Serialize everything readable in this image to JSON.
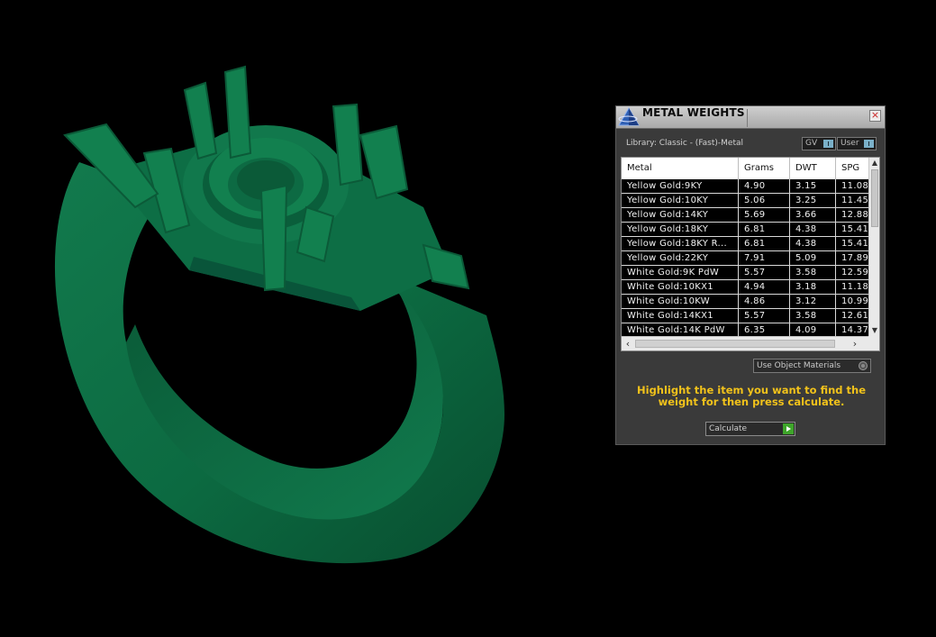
{
  "viewport": {
    "object_color": "#0f6b44",
    "object_icon": "ring-model-icon"
  },
  "panel": {
    "title": "METAL WEIGHTS",
    "close_label": "×",
    "library_label": "Library: Classic - (Fast)-Metal",
    "toggle_gv": "GV",
    "toggle_user": "User",
    "columns": [
      "Metal",
      "Grams",
      "DWT",
      "SPG"
    ],
    "rows": [
      [
        "Yellow Gold:9KY",
        "4.90",
        "3.15",
        "11.08"
      ],
      [
        "Yellow Gold:10KY",
        "5.06",
        "3.25",
        "11.45"
      ],
      [
        "Yellow Gold:14KY",
        "5.69",
        "3.66",
        "12.88"
      ],
      [
        "Yellow Gold:18KY",
        "6.81",
        "4.38",
        "15.41"
      ],
      [
        "Yellow Gold:18KY R...",
        "6.81",
        "4.38",
        "15.41"
      ],
      [
        "Yellow Gold:22KY",
        "7.91",
        "5.09",
        "17.89"
      ],
      [
        "White Gold:9K PdW",
        "5.57",
        "3.58",
        "12.59"
      ],
      [
        "White Gold:10KX1",
        "4.94",
        "3.18",
        "11.18"
      ],
      [
        "White Gold:10KW",
        "4.86",
        "3.12",
        "10.99"
      ],
      [
        "White Gold:14KX1",
        "5.57",
        "3.58",
        "12.61"
      ],
      [
        "White Gold:14K PdW",
        "6.35",
        "4.09",
        "14.37"
      ]
    ],
    "use_object_materials": "Use Object Materials",
    "hint": "Highlight the item you want to find the weight for then press calculate.",
    "calculate_label": "Calculate",
    "hint_color": "#f1c21b"
  }
}
